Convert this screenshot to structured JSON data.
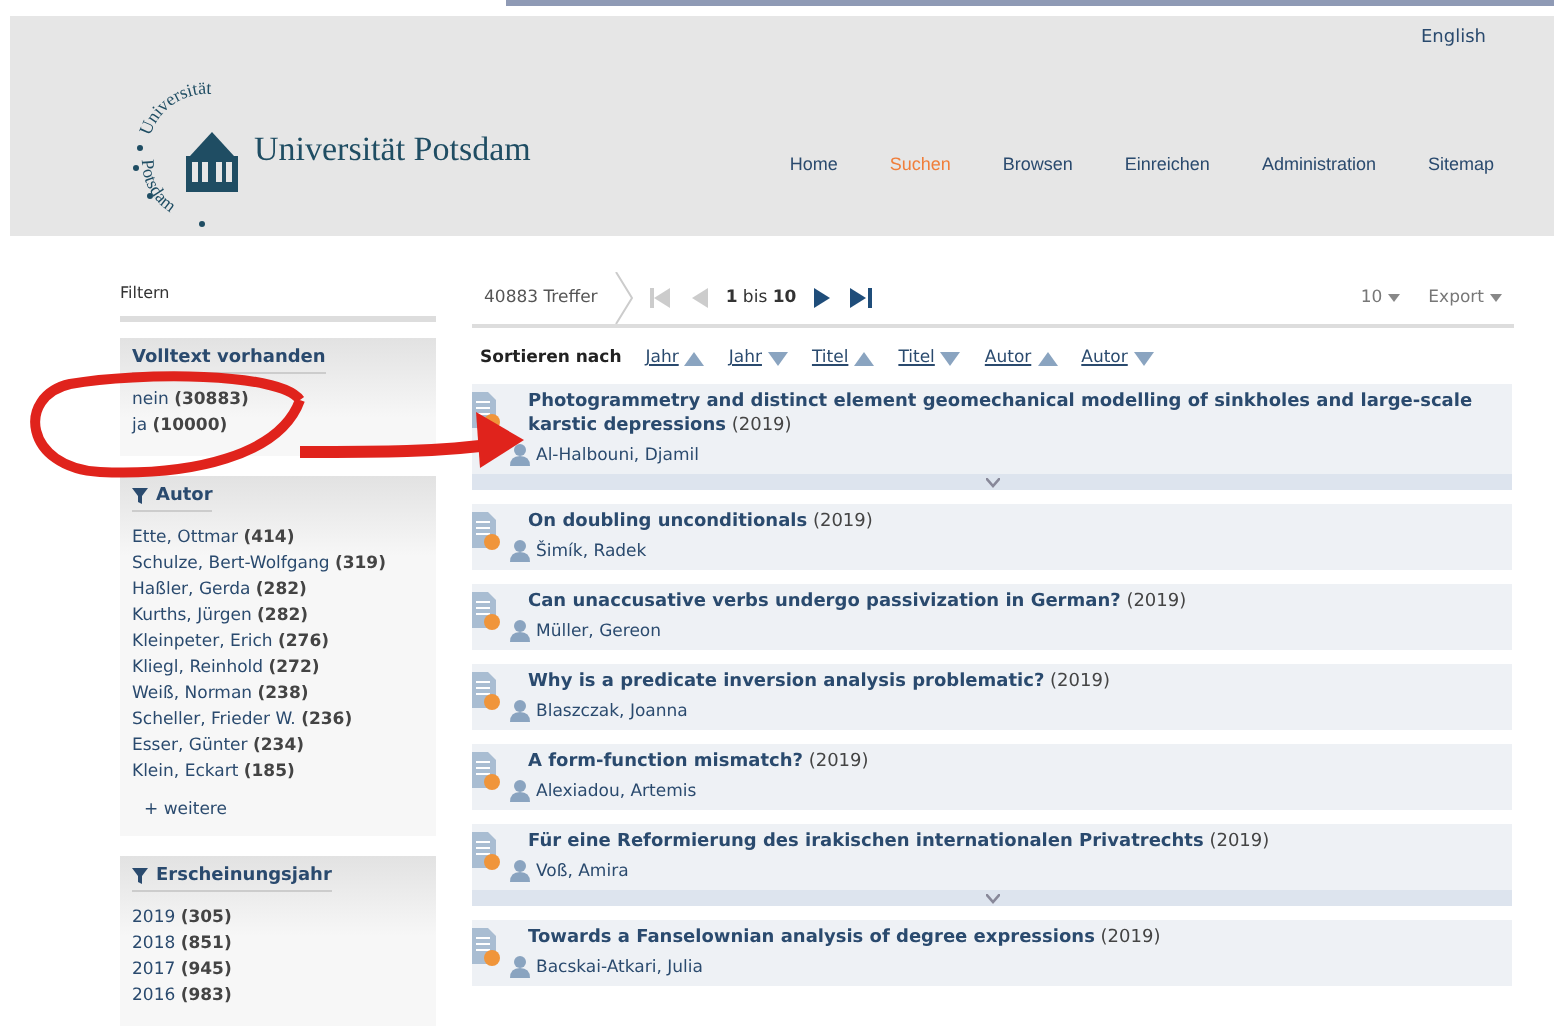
{
  "header": {
    "language": "English",
    "logo": {
      "arc_top": "Universität",
      "arc_bottom": "Potsdam",
      "name": "Universität Potsdam"
    },
    "nav": [
      {
        "label": "Home",
        "selected": false
      },
      {
        "label": "Suchen",
        "selected": true
      },
      {
        "label": "Browsen",
        "selected": false
      },
      {
        "label": "Einreichen",
        "selected": false
      },
      {
        "label": "Administration",
        "selected": false
      },
      {
        "label": "Sitemap",
        "selected": false
      }
    ]
  },
  "sidebar": {
    "title": "Filtern",
    "facets": [
      {
        "title": "Volltext vorhanden",
        "filter_icon": false,
        "items": [
          {
            "label": "nein",
            "count": "(30883)"
          },
          {
            "label": "ja",
            "count": "(10000)"
          }
        ]
      },
      {
        "title": "Autor",
        "filter_icon": true,
        "more": "+ weitere",
        "items": [
          {
            "label": "Ette, Ottmar",
            "count": "(414)"
          },
          {
            "label": "Schulze, Bert-Wolfgang",
            "count": "(319)"
          },
          {
            "label": "Haßler, Gerda",
            "count": "(282)"
          },
          {
            "label": "Kurths, Jürgen",
            "count": "(282)"
          },
          {
            "label": "Kleinpeter, Erich",
            "count": "(276)"
          },
          {
            "label": "Kliegl, Reinhold",
            "count": "(272)"
          },
          {
            "label": "Weiß, Norman",
            "count": "(238)"
          },
          {
            "label": "Scheller, Frieder W.",
            "count": "(236)"
          },
          {
            "label": "Esser, Günter",
            "count": "(234)"
          },
          {
            "label": "Klein, Eckart",
            "count": "(185)"
          }
        ]
      },
      {
        "title": "Erscheinungsjahr",
        "filter_icon": true,
        "items": [
          {
            "label": "2019",
            "count": "(305)"
          },
          {
            "label": "2018",
            "count": "(851)"
          },
          {
            "label": "2017",
            "count": "(945)"
          },
          {
            "label": "2016",
            "count": "(983)"
          }
        ]
      }
    ]
  },
  "results": {
    "count": "40883 Treffer",
    "pager": [
      {
        "kind": "first",
        "disabled": true
      },
      {
        "kind": "prev",
        "disabled": true
      },
      {
        "kind": "range",
        "from": "1",
        "word": "bis",
        "to": "10"
      },
      {
        "kind": "next",
        "disabled": false
      },
      {
        "kind": "last",
        "disabled": false
      }
    ],
    "per_page": "10",
    "export": "Export",
    "sort_label": "Sortieren nach",
    "sort_options": [
      {
        "label": "Jahr",
        "ascending": true
      },
      {
        "label": "Jahr",
        "ascending": false
      },
      {
        "label": "Titel",
        "ascending": true
      },
      {
        "label": "Titel",
        "ascending": false
      },
      {
        "label": "Autor",
        "ascending": true
      },
      {
        "label": "Autor",
        "ascending": false
      }
    ],
    "items": [
      {
        "title": "Photogrammetry and distinct element geomechanical modelling of sinkholes and large-scale karstic depressions",
        "year": "(2019)",
        "author": "Al-Halbouni, Djamil",
        "expandable": true
      },
      {
        "title": "On doubling unconditionals",
        "year": "(2019)",
        "author": "Šimík, Radek",
        "expandable": false
      },
      {
        "title": "Can unaccusative verbs undergo passivization in German?",
        "year": "(2019)",
        "author": "Müller, Gereon",
        "expandable": false
      },
      {
        "title": "Why is a predicate inversion analysis problematic?",
        "year": "(2019)",
        "author": "Blaszczak, Joanna",
        "expandable": false
      },
      {
        "title": "A form-function mismatch?",
        "year": "(2019)",
        "author": "Alexiadou, Artemis",
        "expandable": false
      },
      {
        "title": "Für eine Reformierung des irakischen internationalen Privatrechts",
        "year": "(2019)",
        "author": "Voß, Amira",
        "expandable": true
      },
      {
        "title": "Towards a Fanselownian analysis of degree expressions",
        "year": "(2019)",
        "author": "Bacskai-Atkari, Julia",
        "expandable": false
      }
    ]
  }
}
